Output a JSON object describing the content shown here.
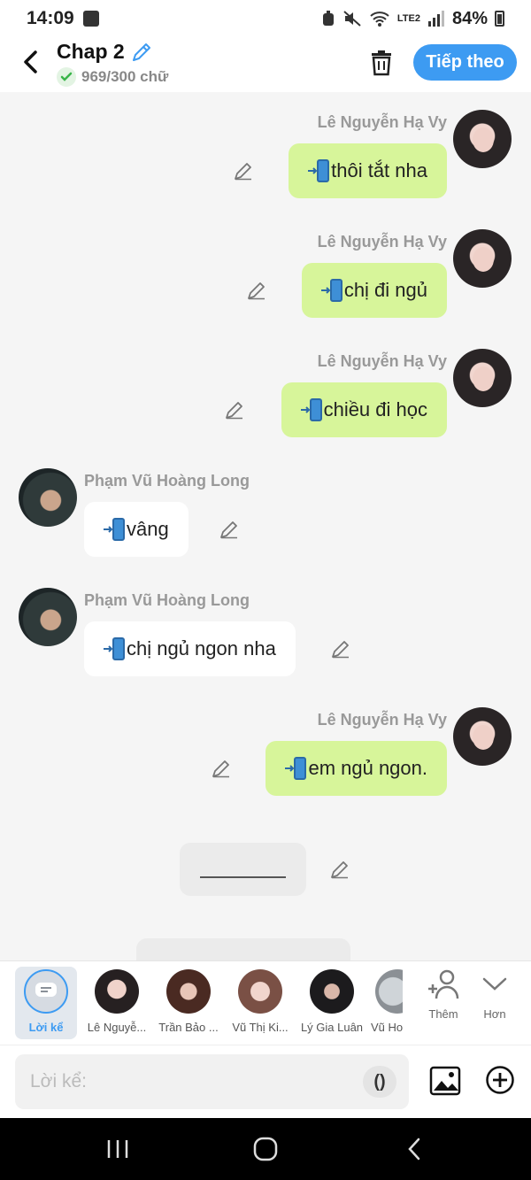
{
  "status": {
    "time": "14:09",
    "battery": "84%",
    "network": "LTE2"
  },
  "header": {
    "title": "Chap 2",
    "count": "969/300 chữ",
    "next_label": "Tiếp theo"
  },
  "messages": [
    {
      "sender": "Lê Nguyễn Hạ Vy",
      "text": "thôi tắt nha",
      "side": "right"
    },
    {
      "sender": "Lê Nguyễn Hạ Vy",
      "text": "chị đi ngủ",
      "side": "right"
    },
    {
      "sender": "Lê Nguyễn Hạ Vy",
      "text": "chiều đi học",
      "side": "right"
    },
    {
      "sender": "Phạm Vũ Hoàng Long",
      "text": "vâng",
      "side": "left"
    },
    {
      "sender": "Phạm Vũ Hoàng Long",
      "text": "chị ngủ ngon nha",
      "side": "left"
    },
    {
      "sender": "Lê Nguyễn Hạ Vy",
      "text": "em ngủ ngon.",
      "side": "right"
    }
  ],
  "characters": [
    {
      "label": "Lời kể",
      "active": true
    },
    {
      "label": "Lê Nguyễ..."
    },
    {
      "label": "Trần Bảo ..."
    },
    {
      "label": "Vũ Thị Ki..."
    },
    {
      "label": "Lý Gia Luân"
    },
    {
      "label": "Vũ Hoà"
    }
  ],
  "more": {
    "add_label": "Thêm",
    "more_label": "Hơn"
  },
  "input": {
    "placeholder": "Lời kể:",
    "paren": "()"
  },
  "colors": {
    "accent": "#3d9bf2",
    "my_bubble": "#d7f59a",
    "their_bubble": "#ffffff"
  }
}
